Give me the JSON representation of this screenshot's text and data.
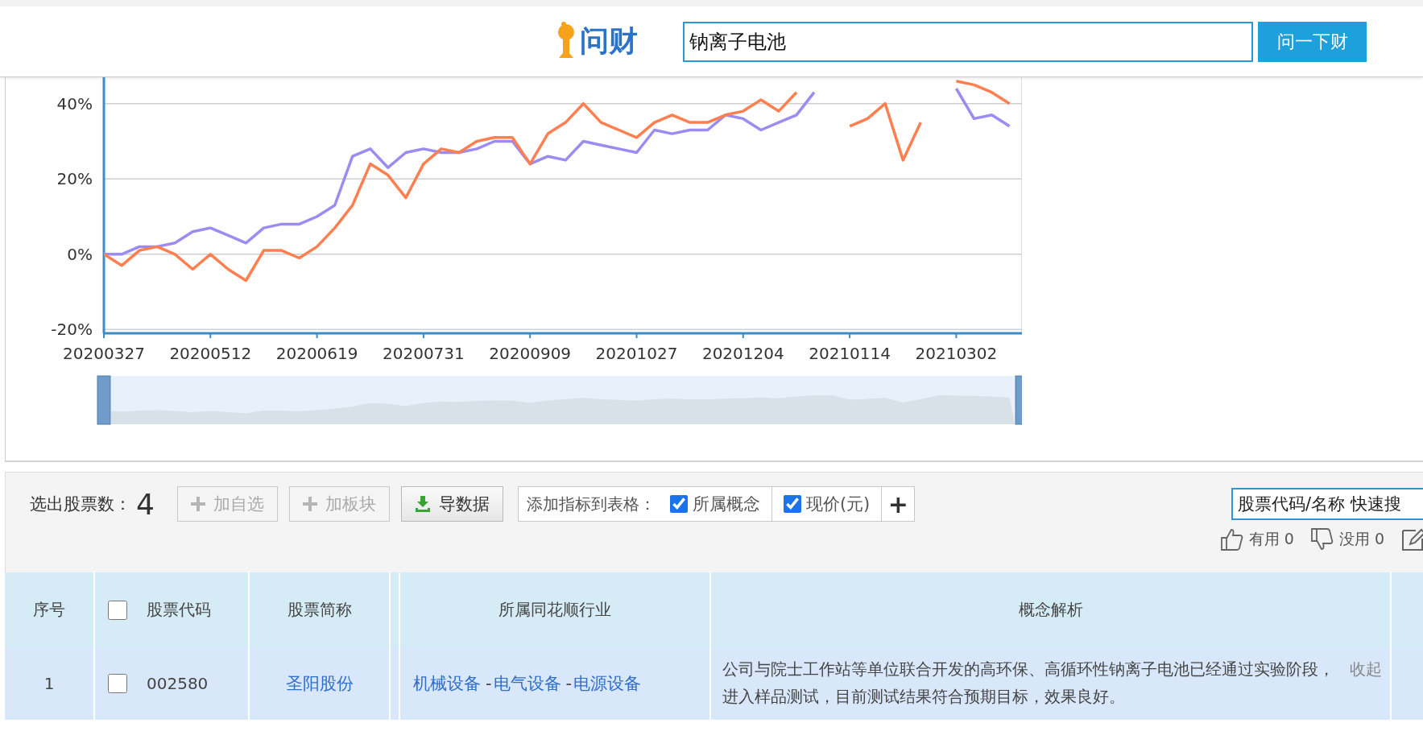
{
  "header": {
    "logo_text": "问财",
    "search": {
      "value": "钠离子电池"
    },
    "search_button": "问一下财"
  },
  "chart": {
    "chart_data": {
      "type": "line",
      "grid": true,
      "categories": [
        "20200327",
        null,
        null,
        null,
        null,
        null,
        "20200512",
        null,
        null,
        null,
        null,
        null,
        "20200619",
        null,
        null,
        null,
        null,
        null,
        "20200731",
        null,
        null,
        null,
        null,
        null,
        "20200909",
        null,
        null,
        null,
        null,
        null,
        "20201027",
        null,
        null,
        null,
        null,
        null,
        "20201204",
        null,
        null,
        null,
        null,
        null,
        "20210114",
        null,
        null,
        null,
        null,
        null,
        "20210302",
        null,
        null,
        null
      ],
      "yticks": [
        {
          "value": 40,
          "label": "40%"
        },
        {
          "value": 20,
          "label": "20%"
        },
        {
          "value": 0,
          "label": "0%"
        },
        {
          "value": -20,
          "label": "-20%"
        }
      ],
      "ylim": [
        -21,
        47
      ],
      "series": [
        {
          "color": "#9b8cf2",
          "values": [
            0,
            0,
            2,
            2,
            3,
            6,
            7,
            5,
            3,
            7,
            8,
            8,
            10,
            13,
            26,
            28,
            23,
            27,
            28,
            27,
            27,
            28,
            30,
            30,
            24,
            26,
            25,
            30,
            29,
            28,
            27,
            33,
            32,
            33,
            33,
            37,
            36,
            33,
            35,
            37,
            43,
            null,
            null,
            null,
            null,
            null,
            null,
            null,
            44,
            36,
            37,
            34
          ]
        },
        {
          "color": "#ff7f50",
          "values": [
            0,
            -3,
            1,
            2,
            0,
            -4,
            0,
            -4,
            -7,
            1,
            1,
            -1,
            2,
            7,
            13,
            24,
            21,
            15,
            24,
            28,
            27,
            30,
            31,
            31,
            24,
            32,
            35,
            40,
            35,
            33,
            31,
            35,
            37,
            35,
            35,
            37,
            38,
            41,
            38,
            43,
            null,
            null,
            34,
            36,
            40,
            25,
            35,
            null,
            46,
            45,
            43,
            40
          ]
        }
      ]
    }
  },
  "toolbar": {
    "count_label": "选出股票数：",
    "count": "4",
    "buttons": [
      {
        "label": "加自选",
        "kind": "add",
        "disabled": true
      },
      {
        "label": "加板块",
        "kind": "add",
        "disabled": true
      },
      {
        "label": "导数据",
        "kind": "export",
        "disabled": false
      }
    ],
    "indicator_label": "添加指标到表格：",
    "indicators": [
      {
        "label": "所属概念",
        "checked": true
      },
      {
        "label": "现价(元)",
        "checked": true
      }
    ],
    "add_indicator": "+",
    "quick_search": {
      "placeholder": "股票代码/名称 快速搜"
    },
    "feedback": [
      {
        "kind": "up",
        "label": "有用",
        "count": "0"
      },
      {
        "kind": "down",
        "label": "没用",
        "count": "0"
      }
    ]
  },
  "table": {
    "select_all": {
      "checked": false
    },
    "columns": [
      "序号",
      "股票代码",
      "股票简称",
      "所属同花顺行业",
      "概念解析"
    ],
    "rows": [
      {
        "index": "1",
        "checked": false,
        "code": "002580",
        "name": "圣阳股份",
        "industry": [
          "机械设备",
          "电气设备",
          "电源设备"
        ],
        "separator": "-",
        "concept": "公司与院士工作站等单位联合开发的高环保、高循环性钠离子电池已经通过实验阶段，进入样品测试，目前测试结果符合预期目标，效果良好。",
        "collapse": "收起"
      }
    ]
  }
}
